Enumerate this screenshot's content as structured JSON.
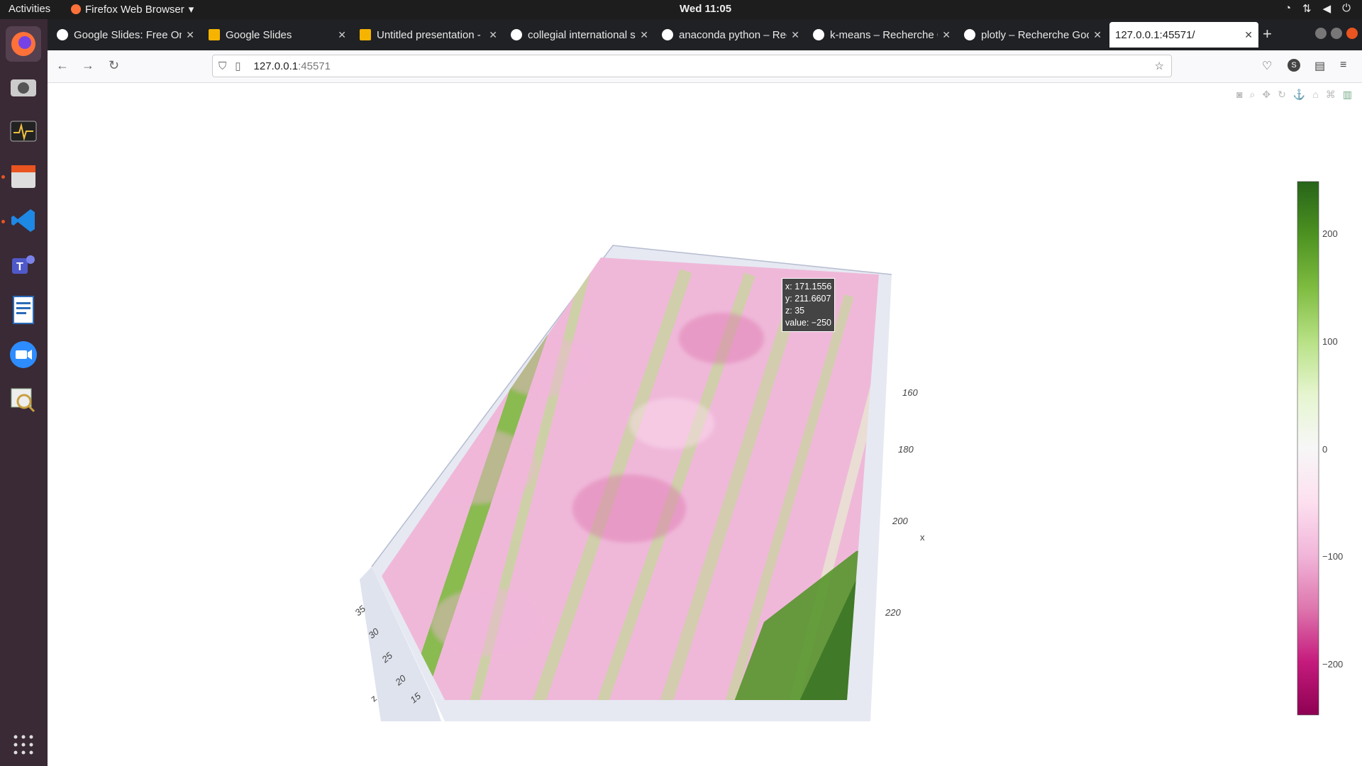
{
  "topbar": {
    "activities": "Activities",
    "app_name": "Firefox Web Browser",
    "clock": "Wed 11:05"
  },
  "dock": {
    "items": [
      "firefox-icon",
      "camera-icon",
      "system-monitor-icon",
      "file-manager-icon",
      "vscode-icon",
      "teams-icon",
      "libreoffice-writer-icon",
      "zoom-icon",
      "image-viewer-icon"
    ],
    "show_apps": "show-apps-icon"
  },
  "tabs": [
    {
      "title": "Google Slides: Free Onl",
      "color": "#ffffff"
    },
    {
      "title": "Google Slides",
      "color": "#f6b400"
    },
    {
      "title": "Untitled presentation - ",
      "color": "#f6b400"
    },
    {
      "title": "collegial international s",
      "color": "#ffffff"
    },
    {
      "title": "anaconda python – Rec",
      "color": "#ffffff"
    },
    {
      "title": "k-means – Recherche G",
      "color": "#ffffff"
    },
    {
      "title": "plotly – Recherche Goo",
      "color": "#ffffff"
    },
    {
      "title": "127.0.0.1:45571/",
      "color": "#ffffff"
    }
  ],
  "url": {
    "host": "127.0.0.1",
    "port": ":45571"
  },
  "plot": {
    "x_ticks": [
      "160",
      "180",
      "200",
      "220"
    ],
    "x_label": "x",
    "z_ticks": [
      "35",
      "30",
      "25",
      "20",
      "15"
    ],
    "z_label": "z",
    "colorbar_ticks": [
      "200",
      "100",
      "0",
      "−100",
      "−200"
    ],
    "colorscale": [
      "#8e0152",
      "#c51b7d",
      "#de77ae",
      "#f1b6da",
      "#fde0ef",
      "#f7f7f7",
      "#e6f5d0",
      "#b8e186",
      "#7fbc41",
      "#4d9221",
      "#276419"
    ],
    "tooltip": {
      "x": "x: 171.1556",
      "y": "y: 211.6607",
      "z": "z: 35",
      "value": "value: −250"
    }
  }
}
